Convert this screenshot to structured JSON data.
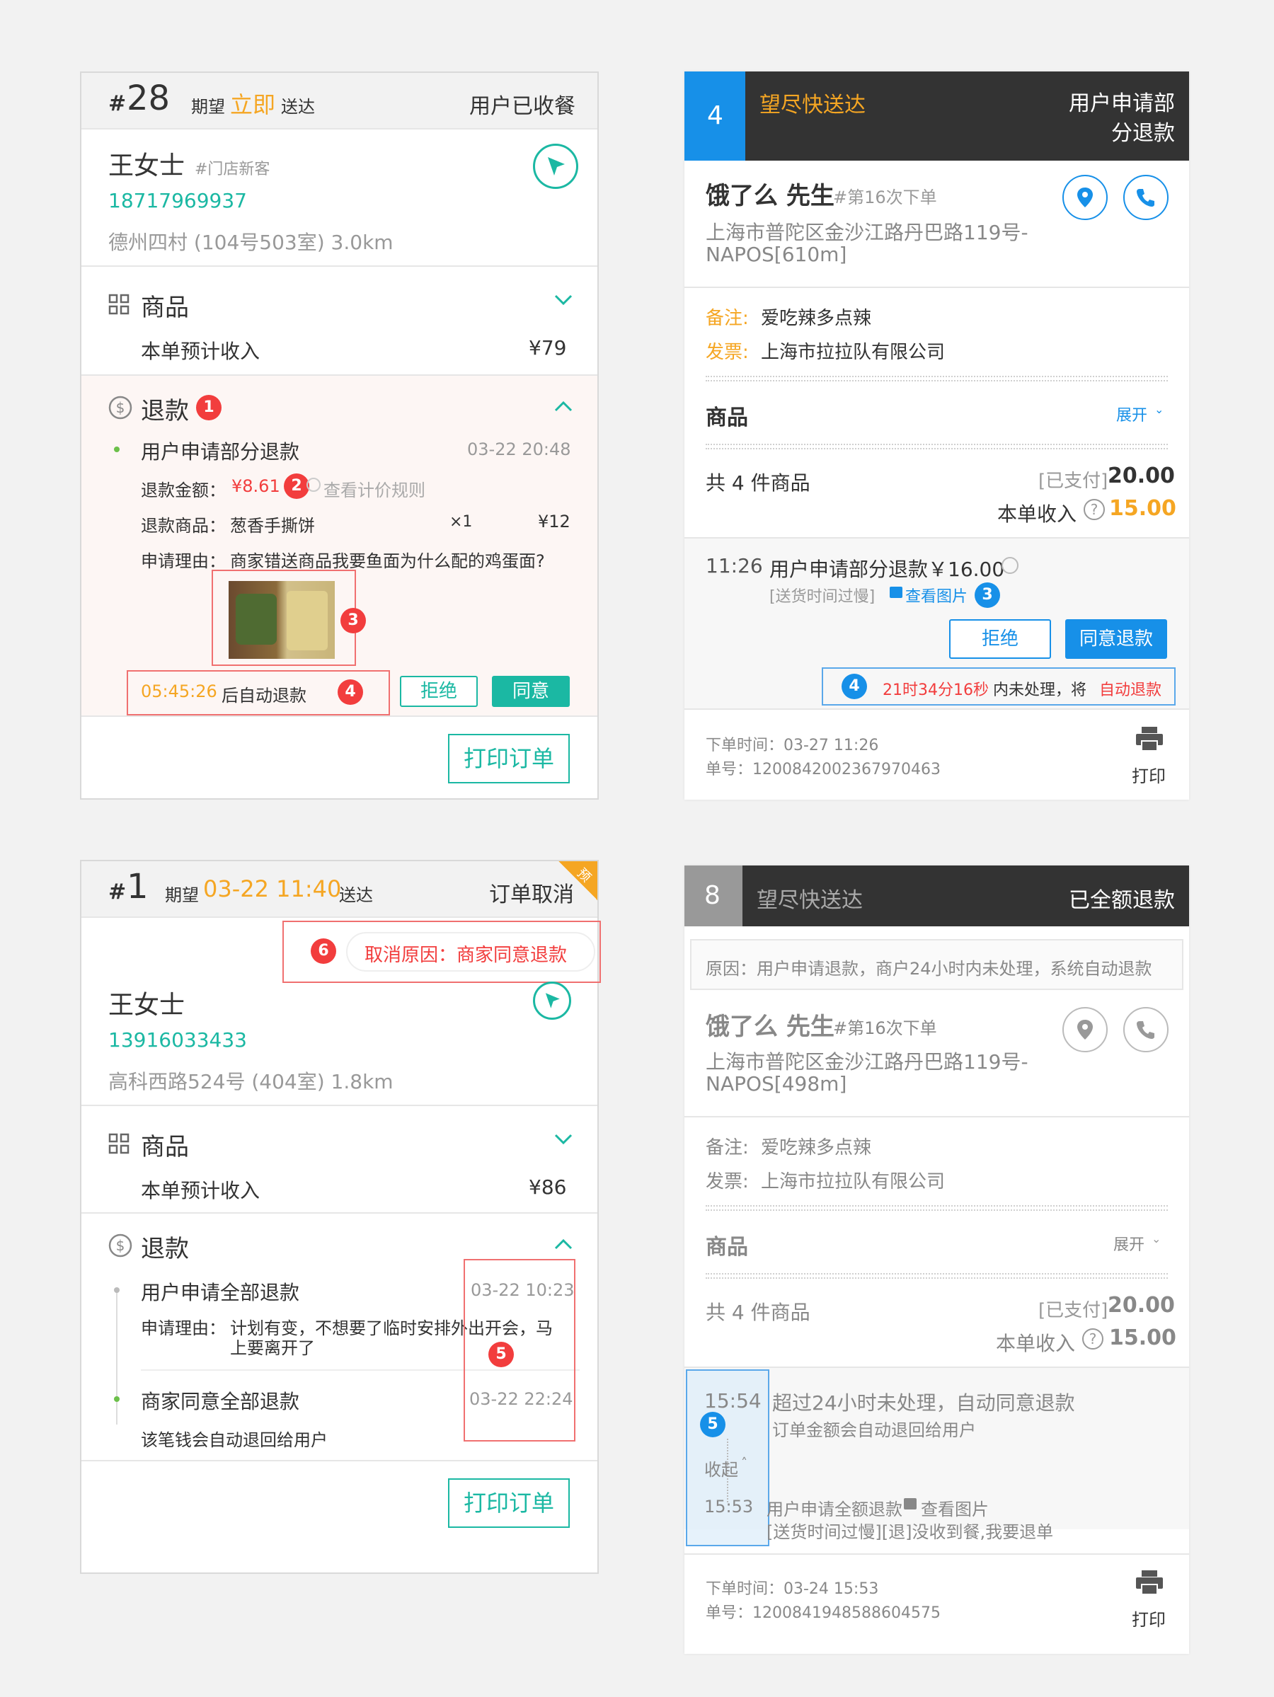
{
  "c1": {
    "num_prefix": "#",
    "num": "28",
    "expect": "期望",
    "when": "立即",
    "deliver": "送达",
    "status": "用户已收餐",
    "name": "王女士",
    "tag": "#门店新客",
    "phone": "18717969937",
    "address": "德州四村 (104号503室)  3.0km",
    "goods": "商品",
    "income_label": "本单预计收入",
    "income_val": "¥79",
    "refund_title": "退款",
    "b1": "1",
    "event": "用户申请部分退款",
    "event_time": "03-22 20:48",
    "amount_label": "退款金额：",
    "amount_val": "¥8.61",
    "b2": "2",
    "rule": "查看计价规则",
    "item_label": "退款商品：",
    "item_name": "葱香手撕饼",
    "item_qty": "×1",
    "item_price": "¥12",
    "reason_label": "申请理由：",
    "reason_text": "商家错送商品我要鱼面为什么配的鸡蛋面?",
    "b3": "3",
    "countdown": "05:45:26",
    "countdown_suffix": "后自动退款",
    "b4": "4",
    "reject": "拒绝",
    "agree": "同意",
    "print": "打印订单"
  },
  "c2": {
    "num": "4",
    "deliver_a": "望",
    "deliver_b": "尽快送达",
    "status_l1": "用户申请部",
    "status_l2": "分退款",
    "name": "饿了么 先生",
    "tag": "#第16次下单",
    "addr_l1": "上海市普陀区金沙江路丹巴路119号-",
    "addr_l2": "NAPOS[610m]",
    "note_label": "备注:",
    "note": "爱吃辣多点辣",
    "invoice_label": "发票:",
    "invoice": "上海市拉拉队有限公司",
    "goods": "商品",
    "expand": "展开",
    "count": "共 4 件商品",
    "paid_label": "[已支付]",
    "paid": "20.00",
    "income_label": "本单收入",
    "income": "15.00",
    "ev_time": "11:26",
    "ev_text": "用户申请部分退款￥16.00",
    "ev_sub": "[送货时间过慢]",
    "view_img": "查看图片",
    "b3": "3",
    "reject": "拒绝",
    "agree": "同意退款",
    "b4": "4",
    "cd_red": "21时34分16秒",
    "cd_mid": "内未处理，将",
    "cd_red2": "自动退款",
    "order_time": "下单时间：03-27 11:26",
    "order_no": "单号：1200842002367970463",
    "print": "打印"
  },
  "c3": {
    "num_prefix": "#",
    "num": "1",
    "expect": "期望",
    "when": "03-22 11:40",
    "deliver": "送达",
    "status": "订单取消",
    "corner": "预",
    "b6": "6",
    "cancel_reason": "取消原因：商家同意退款",
    "name": "王女士",
    "phone": "13916033433",
    "address": "高科西路524号 (404室)  1.8km",
    "goods": "商品",
    "income_label": "本单预计收入",
    "income_val": "¥86",
    "refund_title": "退款",
    "ev1": "用户申请全部退款",
    "ev1_time": "03-22 10:23",
    "reason_label": "申请理由：",
    "reason_l1": "计划有变，不想要了临时安排外出开会，马",
    "reason_l2": "上要离开了",
    "b5": "5",
    "ev2": "商家同意全部退款",
    "ev2_time": "03-22 22:24",
    "ev2_sub": "该笔钱会自动退回给用户",
    "print": "打印订单"
  },
  "c4": {
    "num": "8",
    "deliver": "望尽快送达",
    "status": "已全额退款",
    "reason": "原因：用户申请退款，商户24小时内未处理，系统自动退款",
    "name": "饿了么 先生",
    "tag": "#第16次下单",
    "addr_l1": "上海市普陀区金沙江路丹巴路119号-",
    "addr_l2": "NAPOS[498m]",
    "note_label": "备注:",
    "note": "爱吃辣多点辣",
    "invoice_label": "发票:",
    "invoice": "上海市拉拉队有限公司",
    "goods": "商品",
    "expand": "展开",
    "count": "共 4 件商品",
    "paid_label": "[已支付]",
    "paid": "20.00",
    "income_label": "本单收入",
    "income": "15.00",
    "ev1_time": "15:54",
    "ev1": "超过24小时未处理，自动同意退款",
    "ev1_sub": "订单金额会自动退回给用户",
    "b5": "5",
    "collapse": "收起",
    "ev2_time": "15:53",
    "ev2": "用户申请全额退款",
    "view_img": "查看图片",
    "ev2_sub": "[送货时间过慢][退]没收到餐,我要退单",
    "order_time": "下单时间：03-24 15:53",
    "order_no": "单号：1200841948588604575",
    "print": "打印"
  }
}
